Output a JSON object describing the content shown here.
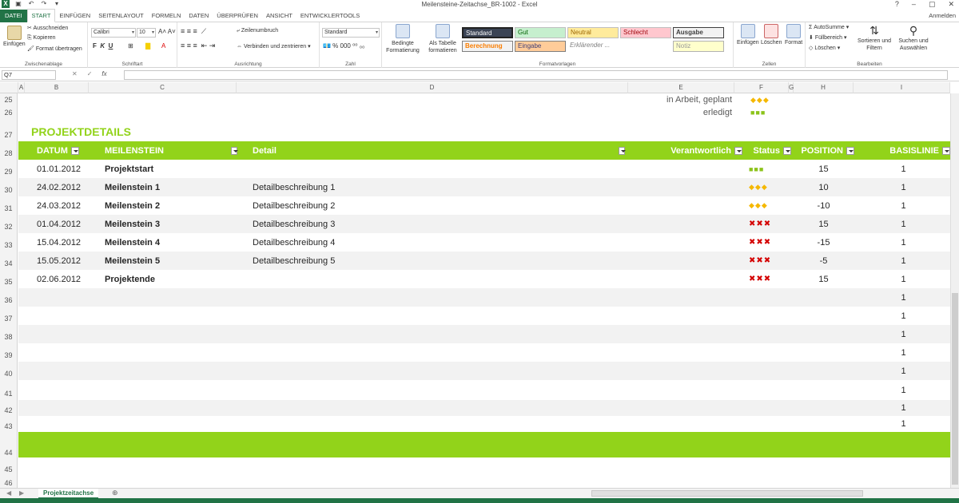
{
  "app": {
    "title": "Meilensteine-Zeitachse_BR-1002 - Excel",
    "signin": "Anmelden"
  },
  "tabs": [
    "DATEI",
    "START",
    "EINFÜGEN",
    "SEITENLAYOUT",
    "FORMELN",
    "DATEN",
    "ÜBERPRÜFEN",
    "ANSICHT",
    "ENTWICKLERTOOLS"
  ],
  "ribbon": {
    "clipboard": {
      "paste": "Einfügen",
      "cut": "Ausschneiden",
      "copy": "Kopieren",
      "format_painter": "Format übertragen",
      "label": "Zwischenablage"
    },
    "font": {
      "name": "Calibri",
      "size": "10",
      "label": "Schriftart"
    },
    "alignment": {
      "wrap": "Zeilenumbruch",
      "merge": "Verbinden und zentrieren",
      "label": "Ausrichtung"
    },
    "number": {
      "format": "Standard",
      "label": "Zahl"
    },
    "styles": {
      "conditional": "Bedingte Formatierung",
      "as_table": "Als Tabelle formatieren",
      "label": "Formatvorlagen",
      "cells": [
        "Standard",
        "Gut",
        "Neutral",
        "Schlecht",
        "Ausgabe",
        "Berechnung",
        "Eingabe",
        "Erklärender ...",
        "Notiz"
      ]
    },
    "cells": {
      "insert": "Einfügen",
      "delete": "Löschen",
      "format": "Format",
      "label": "Zellen"
    },
    "editing": {
      "autosum": "AutoSumme",
      "fill": "Füllbereich",
      "clear": "Löschen",
      "sort": "Sortieren und Filtern",
      "find": "Suchen und Auswählen",
      "label": "Bearbeiten"
    }
  },
  "formula_bar": {
    "name_box": "Q7",
    "fx": "fx",
    "value": ""
  },
  "columns": [
    "A",
    "B",
    "C",
    "D",
    "E",
    "F",
    "G",
    "H",
    "I"
  ],
  "legend": [
    {
      "label": "in Arbeit, geplant",
      "symbol": "◆◆◆"
    },
    {
      "label": "erledigt",
      "symbol": "■■■"
    }
  ],
  "section_title": "PROJEKTDETAILS",
  "table": {
    "headers": {
      "date": "DATUM",
      "milestone": "MEILENSTEIN",
      "detail": "Detail",
      "responsible": "Verantwortlich",
      "status": "Status",
      "position": "POSITION",
      "baseline": "BASISLINIE"
    },
    "rows": [
      {
        "row": "29",
        "date": "01.01.2012",
        "milestone": "Projektstart",
        "detail": "",
        "status": "■■■",
        "status_type": "done",
        "position": "15",
        "baseline": "1"
      },
      {
        "row": "30",
        "date": "24.02.2012",
        "milestone": "Meilenstein 1",
        "detail": "Detailbeschreibung 1",
        "status": "◆◆◆",
        "status_type": "prog",
        "position": "10",
        "baseline": "1"
      },
      {
        "row": "31",
        "date": "24.03.2012",
        "milestone": "Meilenstein 2",
        "detail": "Detailbeschreibung 2",
        "status": "◆◆◆",
        "status_type": "prog",
        "position": "-10",
        "baseline": "1"
      },
      {
        "row": "32",
        "date": "01.04.2012",
        "milestone": "Meilenstein 3",
        "detail": "Detailbeschreibung 3",
        "status": "✖✖✖",
        "status_type": "open",
        "position": "15",
        "baseline": "1"
      },
      {
        "row": "33",
        "date": "15.04.2012",
        "milestone": "Meilenstein 4",
        "detail": "Detailbeschreibung 4",
        "status": "✖✖✖",
        "status_type": "open",
        "position": "-15",
        "baseline": "1"
      },
      {
        "row": "34",
        "date": "15.05.2012",
        "milestone": "Meilenstein 5",
        "detail": "Detailbeschreibung 5",
        "status": "✖✖✖",
        "status_type": "open",
        "position": "-5",
        "baseline": "1"
      },
      {
        "row": "35",
        "date": "02.06.2012",
        "milestone": "Projektende",
        "detail": "",
        "status": "✖✖✖",
        "status_type": "open",
        "position": "15",
        "baseline": "1"
      }
    ],
    "empty_rows": [
      "36",
      "37",
      "38",
      "39",
      "40",
      "41",
      "42",
      "43"
    ],
    "empty_baseline": "1"
  },
  "sheet": {
    "tab": "Projektzeitachse"
  }
}
